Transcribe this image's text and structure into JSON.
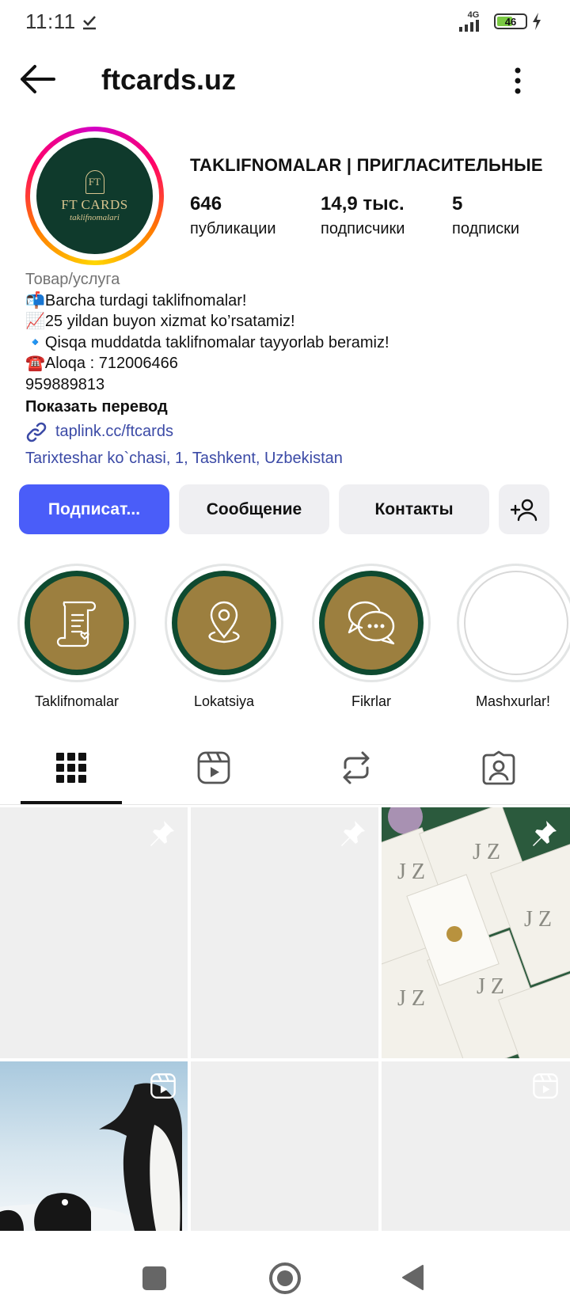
{
  "status_bar": {
    "time": "11:11",
    "network": "4G",
    "battery": "46"
  },
  "header": {
    "title": "ftcards.uz"
  },
  "avatar": {
    "monogram": "FT",
    "brand": "FT CARDS",
    "subtitle": "taklifnomalari"
  },
  "profile": {
    "full_name": "TAKLIFNOMALAR | ПРИГЛАСИТЕЛЬНЫЕ",
    "stats": [
      {
        "value": "646",
        "label": "публикации"
      },
      {
        "value": "14,9 тыс.",
        "label": "подписчики"
      },
      {
        "value": "5",
        "label": "подписки"
      }
    ]
  },
  "bio": {
    "category": "Товар/услуга",
    "lines": [
      "📬Barcha turdagi taklifnomalar!",
      "📈25 yildan buyon xizmat ko’rsatamiz!",
      "🔹Qisqa muddatda taklifnomalar tayyorlab beramiz!",
      "☎️Aloqa : 712006466",
      "959889813"
    ],
    "translate": "Показать перевод",
    "link": "taplink.cc/ftcards",
    "address": "Tarixteshar ko`chasi, 1, Tashkent, Uzbekistan"
  },
  "actions": {
    "follow": "Подписат...",
    "message": "Сообщение",
    "contacts": "Контакты"
  },
  "highlights": [
    {
      "label": "Taklifnomalar",
      "icon": "scroll-icon"
    },
    {
      "label": "Lokatsiya",
      "icon": "location-pin-icon"
    },
    {
      "label": "Fikrlar",
      "icon": "chat-bubbles-icon"
    },
    {
      "label": "Mashxurlar!",
      "icon": "empty"
    }
  ],
  "tabs": [
    "grid-icon",
    "reels-icon",
    "reposts-icon",
    "tagged-icon"
  ],
  "cards_photo": {
    "letters": "J Z",
    "colors": {
      "background": "#2b5a3d",
      "card": "#f3f1ea"
    }
  },
  "colors": {
    "accent": "#4a5df9",
    "link": "#3b4aa6",
    "highlight_ring": "#0e4a30",
    "highlight_fill": "#9c7f3f"
  }
}
